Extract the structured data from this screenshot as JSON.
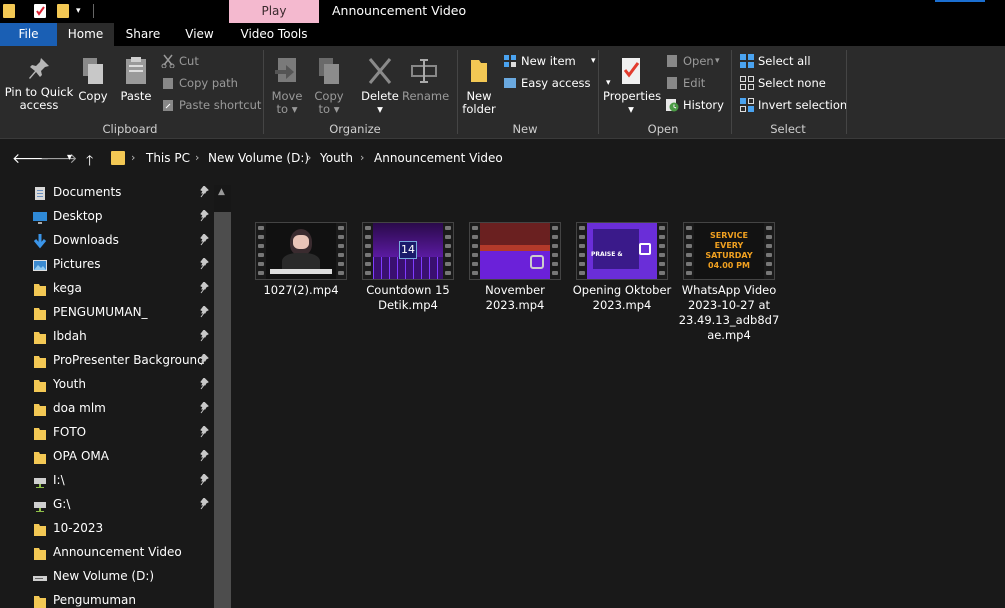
{
  "titlebar": {
    "contextual_tab": "Play",
    "window_title": "Announcement Video"
  },
  "tabs": {
    "file": "File",
    "home": "Home",
    "share": "Share",
    "view": "View",
    "video_tools": "Video Tools"
  },
  "ribbon": {
    "clipboard": {
      "pin": "Pin to Quick access",
      "copy": "Copy",
      "paste": "Paste",
      "cut": "Cut",
      "copy_path": "Copy path",
      "paste_shortcut": "Paste shortcut",
      "label": "Clipboard"
    },
    "organize": {
      "move_to": "Move to",
      "copy_to": "Copy to",
      "delete": "Delete",
      "rename": "Rename",
      "label": "Organize"
    },
    "new": {
      "new_folder": "New folder",
      "new_item": "New item",
      "easy_access": "Easy access",
      "label": "New"
    },
    "open": {
      "properties": "Properties",
      "open": "Open",
      "edit": "Edit",
      "history": "History",
      "label": "Open"
    },
    "select": {
      "select_all": "Select all",
      "select_none": "Select none",
      "invert_selection": "Invert selection",
      "label": "Select"
    }
  },
  "address": {
    "crumbs": [
      "This PC",
      "New Volume (D:)",
      "Youth",
      "Announcement Video"
    ]
  },
  "sidebar": {
    "items": [
      {
        "label": "Documents",
        "icon": "documents-icon",
        "pinned": true
      },
      {
        "label": "Desktop",
        "icon": "desktop-icon",
        "pinned": true
      },
      {
        "label": "Downloads",
        "icon": "downloads-icon",
        "pinned": true
      },
      {
        "label": "Pictures",
        "icon": "pictures-icon",
        "pinned": true
      },
      {
        "label": "kega",
        "icon": "folder-icon",
        "pinned": true
      },
      {
        "label": "PENGUMUMAN_",
        "icon": "folder-icon",
        "pinned": true
      },
      {
        "label": "Ibdah",
        "icon": "folder-icon",
        "pinned": true
      },
      {
        "label": "ProPresenter Background",
        "icon": "folder-icon",
        "pinned": true
      },
      {
        "label": "Youth",
        "icon": "folder-icon",
        "pinned": true
      },
      {
        "label": "doa mlm",
        "icon": "folder-icon",
        "pinned": true
      },
      {
        "label": "FOTO",
        "icon": "folder-icon",
        "pinned": true
      },
      {
        "label": "OPA OMA",
        "icon": "folder-icon",
        "pinned": true
      },
      {
        "label": "I:\\",
        "icon": "network-drive-icon",
        "pinned": true
      },
      {
        "label": "G:\\",
        "icon": "network-drive-icon",
        "pinned": true
      },
      {
        "label": "10-2023",
        "icon": "folder-icon",
        "pinned": false
      },
      {
        "label": "Announcement Video",
        "icon": "folder-icon",
        "pinned": false
      },
      {
        "label": "New Volume (D:)",
        "icon": "drive-icon",
        "pinned": false
      },
      {
        "label": "Pengumuman",
        "icon": "folder-icon",
        "pinned": false
      }
    ]
  },
  "files": [
    {
      "name": "1027(2).mp4",
      "thumb_text": ""
    },
    {
      "name": "Countdown 15 Detik.mp4",
      "thumb_text": "14"
    },
    {
      "name": "November 2023.mp4",
      "thumb_text": ""
    },
    {
      "name": "Opening Oktober 2023.mp4",
      "thumb_text": "PRAISE &"
    },
    {
      "name": "WhatsApp Video 2023-10-27 at 23.49.13_adb8d7ae.mp4",
      "thumb_text": "SERVICE EVERY SATURDAY 04.00 PM"
    }
  ],
  "colors": {
    "accent": "#1a5fb4",
    "folder": "#f3c854",
    "play_tab": "#f4b9cf"
  }
}
